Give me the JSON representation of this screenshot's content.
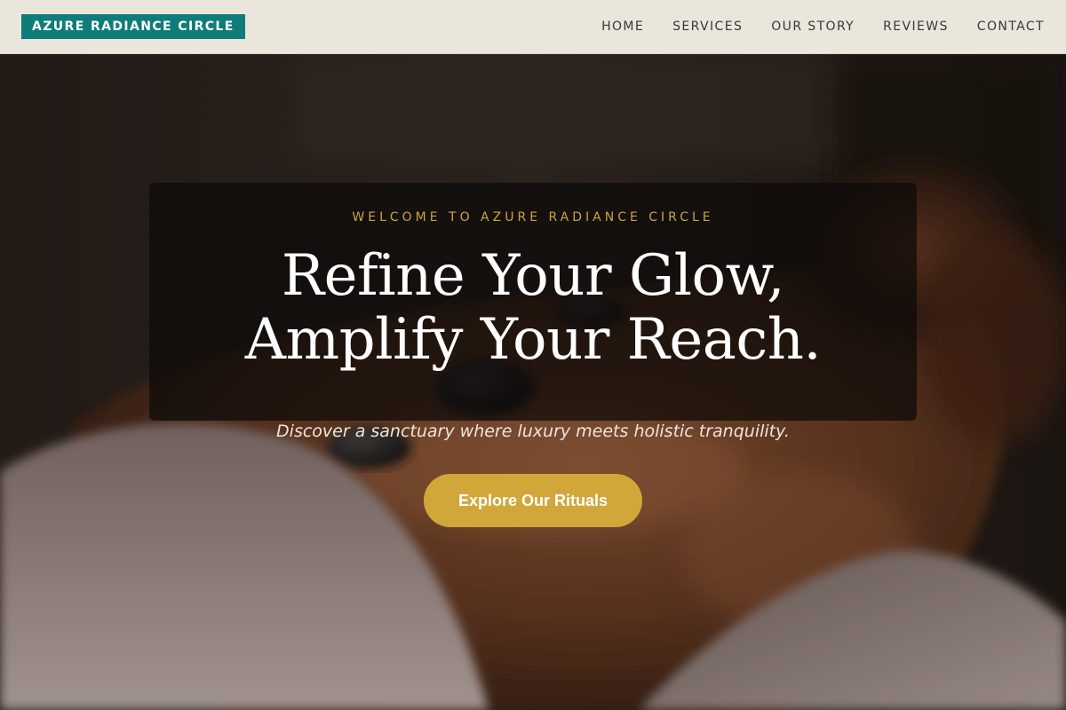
{
  "header": {
    "brand_name": "AZURE RADIANCE CIRCLE",
    "nav": [
      {
        "label": "HOME"
      },
      {
        "label": "SERVICES"
      },
      {
        "label": "OUR STORY"
      },
      {
        "label": "REVIEWS"
      },
      {
        "label": "CONTACT"
      }
    ]
  },
  "hero": {
    "eyebrow": "WELCOME TO AZURE RADIANCE CIRCLE",
    "title_line1": "Refine Your Glow,",
    "title_line2": "Amplify Your Reach.",
    "tagline": "Discover a sanctuary where luxury meets holistic tranquility.",
    "cta_label": "Explore Our Rituals"
  },
  "colors": {
    "header_bg": "#ebe6dc",
    "brand_bg": "#0e7d7a",
    "accent_gold": "#d1a73a",
    "eyebrow_gold": "#c9a24a",
    "hero_card": "#0c0a09"
  }
}
